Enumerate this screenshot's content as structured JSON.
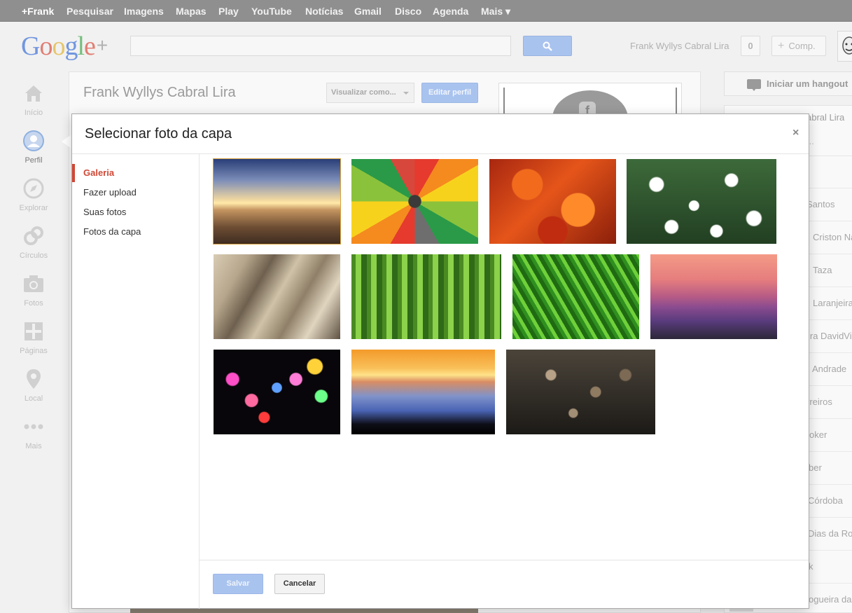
{
  "gbar": {
    "items": [
      "+Frank",
      "Pesquisar",
      "Imagens",
      "Mapas",
      "Play",
      "YouTube",
      "Notícias",
      "Gmail",
      "Disco",
      "Agenda",
      "Mais ▾"
    ]
  },
  "header": {
    "logo_letters": [
      "G",
      "o",
      "o",
      "g",
      "l",
      "e"
    ],
    "logo_plus": "+",
    "search_value": "",
    "user_name": "Frank Wyllys Cabral Lira",
    "notifications": "0",
    "share_label": "Comp.",
    "share_plus": "+"
  },
  "nav": {
    "items": [
      {
        "label": "Início",
        "icon": "home-icon"
      },
      {
        "label": "Perfil",
        "icon": "profile-icon"
      },
      {
        "label": "Explorar",
        "icon": "compass-icon"
      },
      {
        "label": "Círculos",
        "icon": "circles-icon"
      },
      {
        "label": "Fotos",
        "icon": "camera-icon"
      },
      {
        "label": "Páginas",
        "icon": "pages-icon"
      },
      {
        "label": "Local",
        "icon": "pin-icon"
      },
      {
        "label": "Mais",
        "icon": "more-icon"
      }
    ],
    "active": "Perfil"
  },
  "profile": {
    "name": "Frank Wyllys Cabral Lira",
    "view_as": "Visualizar como...",
    "edit": "Editar perfil",
    "fb_letter": "f"
  },
  "right": {
    "hangout": "Iniciar um hangout",
    "name_partial": "abral Lira",
    "search_partial": "...",
    "contacts": [
      "Santos",
      "Criston Na",
      "Taza",
      "Laranjeira",
      "ira DavidVi",
      "Andrade",
      "rreiros",
      "oker",
      "ber",
      "Córdoba",
      "Dias da Ro",
      "k",
      "ogueira da"
    ]
  },
  "dialog": {
    "title": "Selecionar foto da capa",
    "close": "×",
    "menu": [
      "Galeria",
      "Fazer upload",
      "Suas fotos",
      "Fotos da capa"
    ],
    "active_menu": "Galeria",
    "save": "Salvar",
    "cancel": "Cancelar",
    "gallery": [
      {
        "name": "beach-sunset",
        "selected": true
      },
      {
        "name": "colorful-petals"
      },
      {
        "name": "red-maple-leaves"
      },
      {
        "name": "white-daisies"
      },
      {
        "name": "paper-folds"
      },
      {
        "name": "horsetail-plants"
      },
      {
        "name": "green-grass"
      },
      {
        "name": "pink-mountains"
      },
      {
        "name": "bokeh-lights"
      },
      {
        "name": "sunset-over-clouds"
      },
      {
        "name": "water-drops"
      }
    ]
  },
  "colors": {
    "gbar": "#8f8f8f",
    "accent_blue": "#a9c3ef",
    "active_red": "#d14836"
  }
}
